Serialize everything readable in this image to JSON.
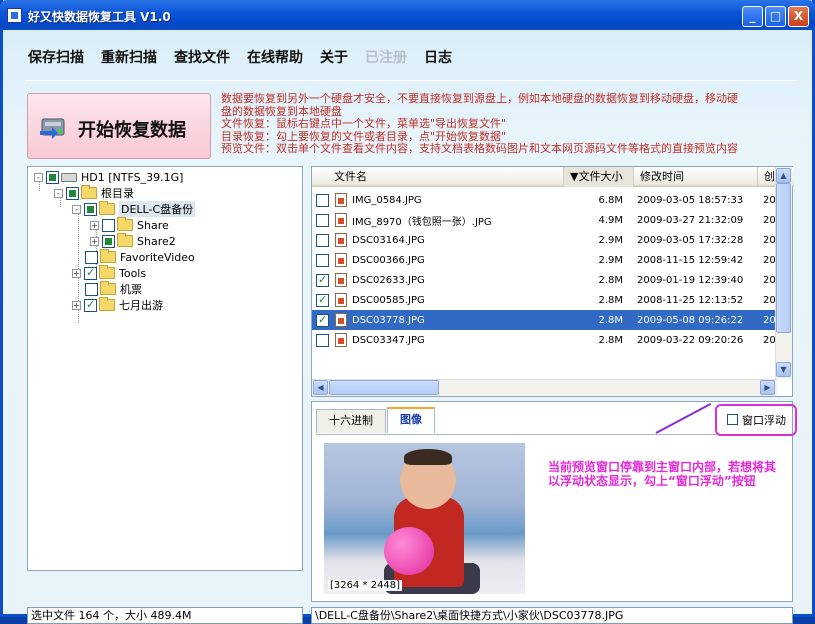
{
  "window": {
    "title": "好又快数据恢复工具 V1.0"
  },
  "titlebar_buttons": {
    "minimize": "_",
    "maximize": "□",
    "close": "X"
  },
  "menu": [
    "保存扫描",
    "重新扫描",
    "查找文件",
    "在线帮助",
    "关于",
    "已注册",
    "日志"
  ],
  "start_button": {
    "label": "开始恢复数据"
  },
  "info_lines": [
    "数据要恢复到另外一个硬盘才安全，不要直接恢复到源盘上，例如本地硬盘的数据恢复到移动硬盘，移动硬",
    "盘的数据恢复到本地硬盘",
    "文件恢复：鼠标右键点中一个文件，菜单选\"导出恢复文件\"",
    "目录恢复：勾上要恢复的文件或者目录，点\"开始恢复数据\"",
    "预览文件：双击单个文件查看文件内容，支持文档表格数码图片和文本网页源码文件等格式的直接预览内容"
  ],
  "tree": [
    {
      "label": "HD1  [NTFS_39.1G]",
      "type": "drive",
      "state": "partial",
      "expander": "-",
      "level": 0
    },
    {
      "label": "根目录",
      "type": "folder",
      "state": "partial",
      "expander": "-",
      "level": 1
    },
    {
      "label": "DELL-C盘备份",
      "type": "folder",
      "state": "partial",
      "expander": "-",
      "level": 2,
      "highlight": true
    },
    {
      "label": "Share",
      "type": "folder",
      "state": "none",
      "expander": "+",
      "level": 3
    },
    {
      "label": "Share2",
      "type": "folder",
      "state": "partial",
      "expander": "+",
      "level": 3
    },
    {
      "label": "FavoriteVideo",
      "type": "folder",
      "state": "none",
      "expander": "",
      "level": 2
    },
    {
      "label": "Tools",
      "type": "folder",
      "state": "checked",
      "expander": "+",
      "level": 2
    },
    {
      "label": "机票",
      "type": "folder",
      "state": "none",
      "expander": "",
      "level": 2
    },
    {
      "label": "七月出游",
      "type": "folder",
      "state": "checked",
      "expander": "+",
      "level": 2
    }
  ],
  "list": {
    "columns": [
      "文件名",
      "▼文件大小",
      "修改时间",
      "创"
    ],
    "rows": [
      {
        "name": "IMG_0584.JPG",
        "size": "6.8M",
        "time": "2009-03-05 18:57:33",
        "extra": "20",
        "checked": false,
        "selected": false
      },
      {
        "name": "IMG_8970（钱包照一张）.JPG",
        "size": "4.9M",
        "time": "2009-03-27 21:32:09",
        "extra": "20",
        "checked": false,
        "selected": false
      },
      {
        "name": "DSC03164.JPG",
        "size": "2.9M",
        "time": "2009-03-05 17:32:28",
        "extra": "20",
        "checked": false,
        "selected": false
      },
      {
        "name": "DSC00366.JPG",
        "size": "2.9M",
        "time": "2008-11-15 12:59:42",
        "extra": "20",
        "checked": false,
        "selected": false
      },
      {
        "name": "DSC02633.JPG",
        "size": "2.8M",
        "time": "2009-01-19 12:39:40",
        "extra": "20",
        "checked": true,
        "selected": false
      },
      {
        "name": "DSC00585.JPG",
        "size": "2.8M",
        "time": "2008-11-25 12:13:52",
        "extra": "20",
        "checked": true,
        "selected": false
      },
      {
        "name": "DSC03778.JPG",
        "size": "2.8M",
        "time": "2009-05-08 09:26:22",
        "extra": "20",
        "checked": true,
        "selected": true
      },
      {
        "name": "DSC03347.JPG",
        "size": "2.8M",
        "time": "2009-03-22 09:20:26",
        "extra": "20",
        "checked": false,
        "selected": false
      }
    ]
  },
  "preview": {
    "tabs": [
      "十六进制",
      "图像"
    ],
    "active_tab": "图像",
    "float_label": "窗口浮动",
    "image_size": "[3264 * 2448]"
  },
  "annotation": "当前预览窗口停靠到主窗口内部，若想将其以浮动状态显示，勾上“窗口浮动”按钮",
  "status": {
    "left": "选中文件 164 个，大小 489.4M",
    "right": "\\DELL-C盘备份\\Share2\\桌面快捷方式\\小家伙\\DSC03778.JPG"
  },
  "colors": {
    "info_text": "#c0302a",
    "annotation": "#e52ad8",
    "selection": "#316ac5",
    "float_highlight": "#d830d8"
  }
}
